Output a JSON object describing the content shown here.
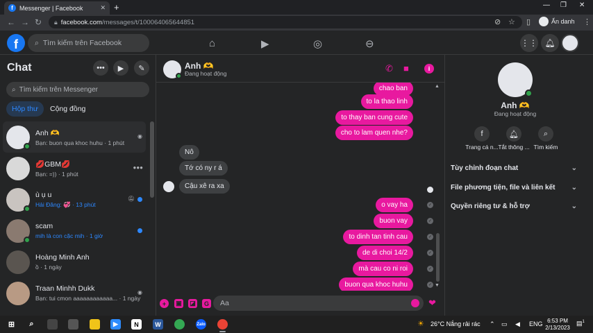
{
  "browser": {
    "tab_title": "Messenger | Facebook",
    "url_host": "facebook.com",
    "url_path": "/messages/t/100064065644851",
    "profile_label": "Ẩn danh"
  },
  "fb": {
    "logo": "f",
    "search_placeholder": "Tìm kiếm trên Facebook"
  },
  "sidebar": {
    "title": "Chat",
    "search_placeholder": "Tìm kiếm trên Messenger",
    "tabs": [
      "Hộp thư",
      "Cộng đồng"
    ],
    "conversations": [
      {
        "name": "Anh 🫶",
        "preview": "Bạn: buon qua khoc huhu · 1 phút",
        "avatar_color": "#e4e6eb",
        "online": true
      },
      {
        "name": "💋GBM💋",
        "preview": "Bạn: =)) · 1 phút",
        "avatar_color": "#d9d9d9",
        "online": false
      },
      {
        "name": "ù ụ u",
        "preview": "Hải Đăng: 💞 · 13 phút",
        "avatar_color": "#c9c4c0",
        "online": true
      },
      {
        "name": "scam",
        "preview": "mih là con cặc mih · 1 giờ",
        "avatar_color": "#8a7a70",
        "online": true
      },
      {
        "name": "Hoàng Minh Anh",
        "preview": "ồ · 1 ngày",
        "avatar_color": "#5a5550",
        "online": false
      },
      {
        "name": "Traan Minhh Dukk",
        "preview": "Bạn: tui cmon aaaaaaaaaaaa... · 1 ngày",
        "avatar_color": "#b89a84",
        "online": false
      }
    ]
  },
  "conversation": {
    "name": "Anh 🫶",
    "status": "Đang hoạt động",
    "messages_me_top": [
      "chao ban",
      "to la thao linh",
      "to thay ban cung cute",
      "cho to lam quen nhe?"
    ],
    "messages_them": [
      "Nô",
      "Tớ có ny r á",
      "Cậu xê ra xa"
    ],
    "messages_me_bottom": [
      "o vay ha",
      "buon vay",
      "to dinh tan tinh cau",
      "de di choi 14/2",
      "mà cau co ni roi",
      "buon qua khoc huhu"
    ],
    "composer_placeholder": "Aa"
  },
  "info_panel": {
    "name": "Anh 🫶",
    "status": "Đang hoạt động",
    "actions": [
      "Trang cá n...",
      "Tắt thông ...",
      "Tìm kiếm"
    ],
    "sections": [
      "Tùy chỉnh đoạn chat",
      "File phương tiện, file và liên kết",
      "Quyền riêng tư & hỗ trợ"
    ]
  },
  "taskbar": {
    "weather": "26°C  Nắng rải rác",
    "lang": "ENG",
    "time": "6:53 PM",
    "date": "2/13/2023",
    "notif_count": "1"
  },
  "colors": {
    "accent_pink": "#e8199f",
    "fb_blue": "#1877f2",
    "online_green": "#31a24c"
  }
}
